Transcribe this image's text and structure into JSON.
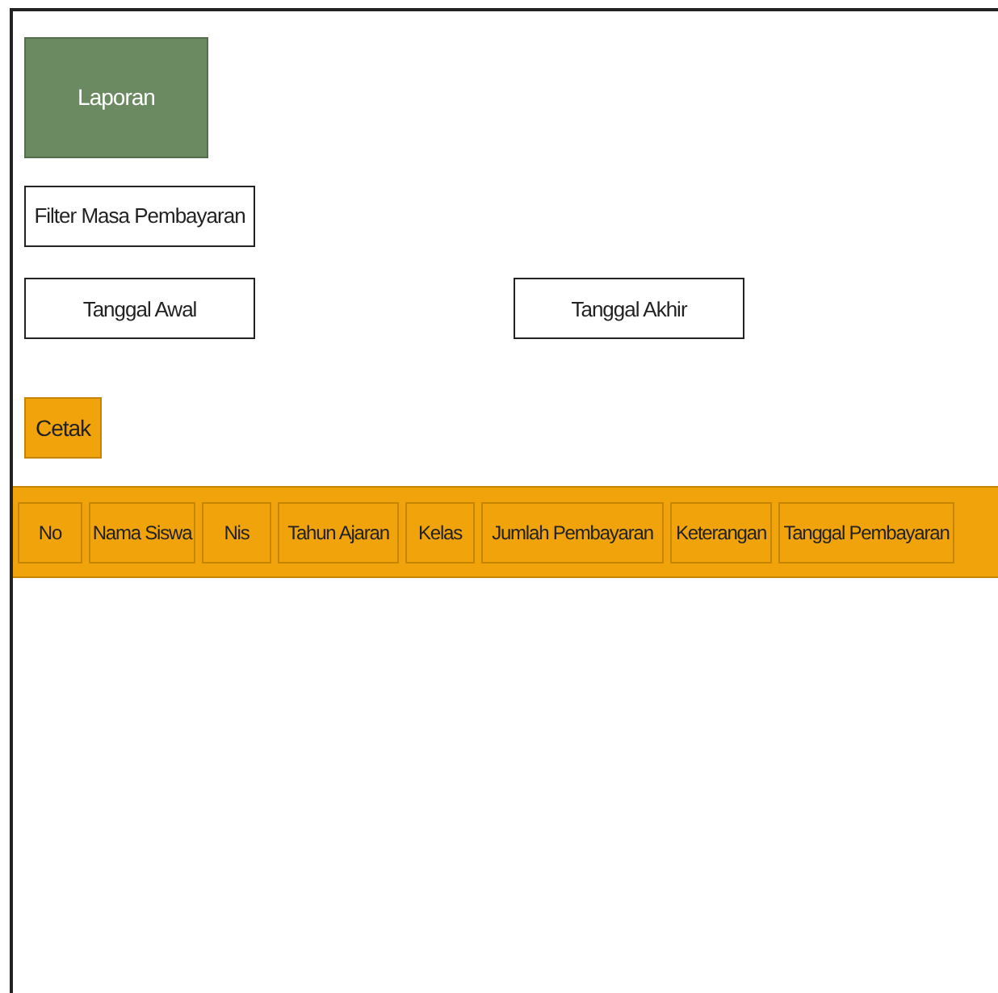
{
  "title": "Laporan",
  "filter": {
    "label": "Filter Masa Pembayaran"
  },
  "date_fields": [
    {
      "placeholder": "Tanggal Awal"
    },
    {
      "placeholder": "Tanggal Akhir"
    }
  ],
  "print_button": {
    "label": "Cetak"
  },
  "table": {
    "columns": [
      "No",
      "Nama Siswa",
      "Nis",
      "Tahun Ajaran",
      "Kelas",
      "Jumlah Pembayaran",
      "Keterangan",
      "Tanggal Pembayaran"
    ]
  }
}
